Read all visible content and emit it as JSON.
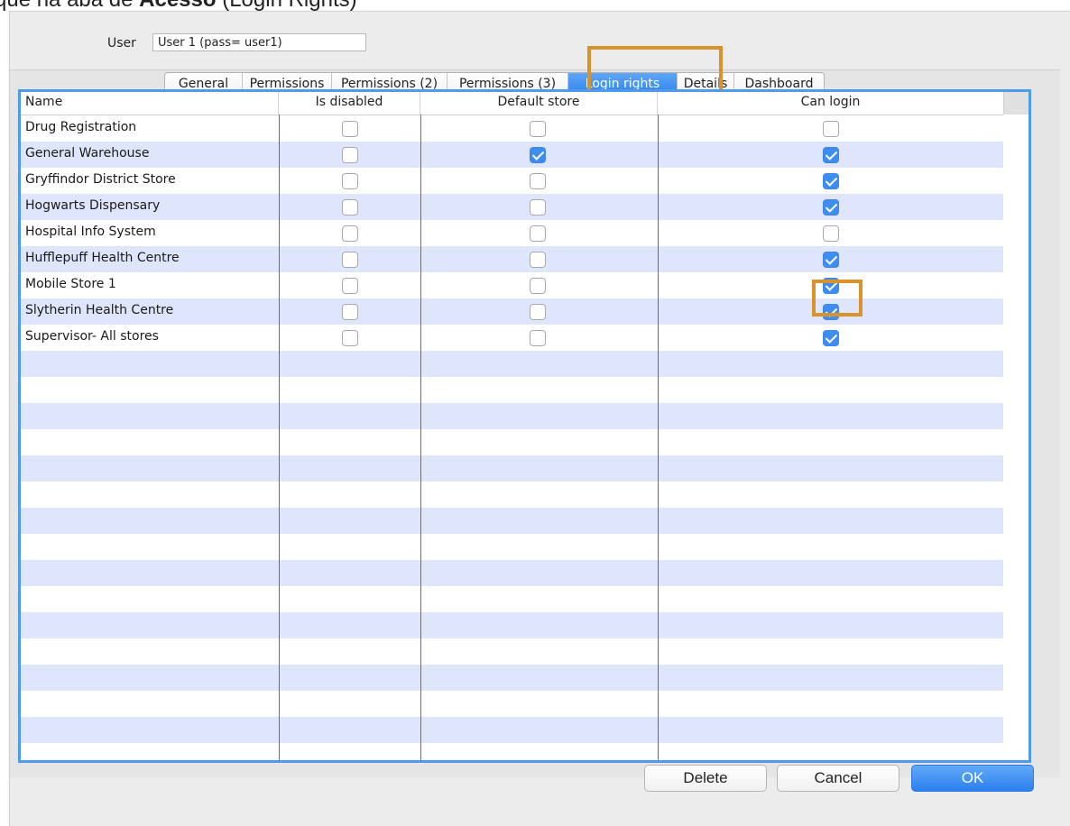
{
  "caption": {
    "prefix": "que na aba de ",
    "bold": "Acesso",
    "suffix": " (Login Rights)"
  },
  "user": {
    "label": "User",
    "value": "User 1 (pass= user1)"
  },
  "tabs": [
    {
      "label": "General",
      "active": false
    },
    {
      "label": "Permissions",
      "active": false
    },
    {
      "label": "Permissions (2)",
      "active": false
    },
    {
      "label": "Permissions (3)",
      "active": false
    },
    {
      "label": "Login rights",
      "active": true
    },
    {
      "label": "Details",
      "active": false
    },
    {
      "label": "Dashboard",
      "active": false
    }
  ],
  "table": {
    "columns": [
      "Name",
      "Is disabled",
      "Default store",
      "Can login"
    ],
    "rows": [
      {
        "name": "Drug Registration",
        "is_disabled": false,
        "default_store": false,
        "can_login": false
      },
      {
        "name": "General Warehouse",
        "is_disabled": false,
        "default_store": true,
        "can_login": true
      },
      {
        "name": "Gryffindor District Store",
        "is_disabled": false,
        "default_store": false,
        "can_login": true
      },
      {
        "name": "Hogwarts Dispensary",
        "is_disabled": false,
        "default_store": false,
        "can_login": true
      },
      {
        "name": "Hospital Info System",
        "is_disabled": false,
        "default_store": false,
        "can_login": false
      },
      {
        "name": "Hufflepuff Health Centre",
        "is_disabled": false,
        "default_store": false,
        "can_login": true
      },
      {
        "name": "Mobile Store 1",
        "is_disabled": false,
        "default_store": false,
        "can_login": true
      },
      {
        "name": "Slytherin Health Centre",
        "is_disabled": false,
        "default_store": false,
        "can_login": true
      },
      {
        "name": "Supervisor- All stores",
        "is_disabled": false,
        "default_store": false,
        "can_login": true
      }
    ]
  },
  "buttons": {
    "delete": "Delete",
    "cancel": "Cancel",
    "ok": "OK"
  },
  "colors": {
    "highlight": "#d8932c",
    "accent": "#3e8ef2",
    "stripe": "#dfe5fb"
  }
}
